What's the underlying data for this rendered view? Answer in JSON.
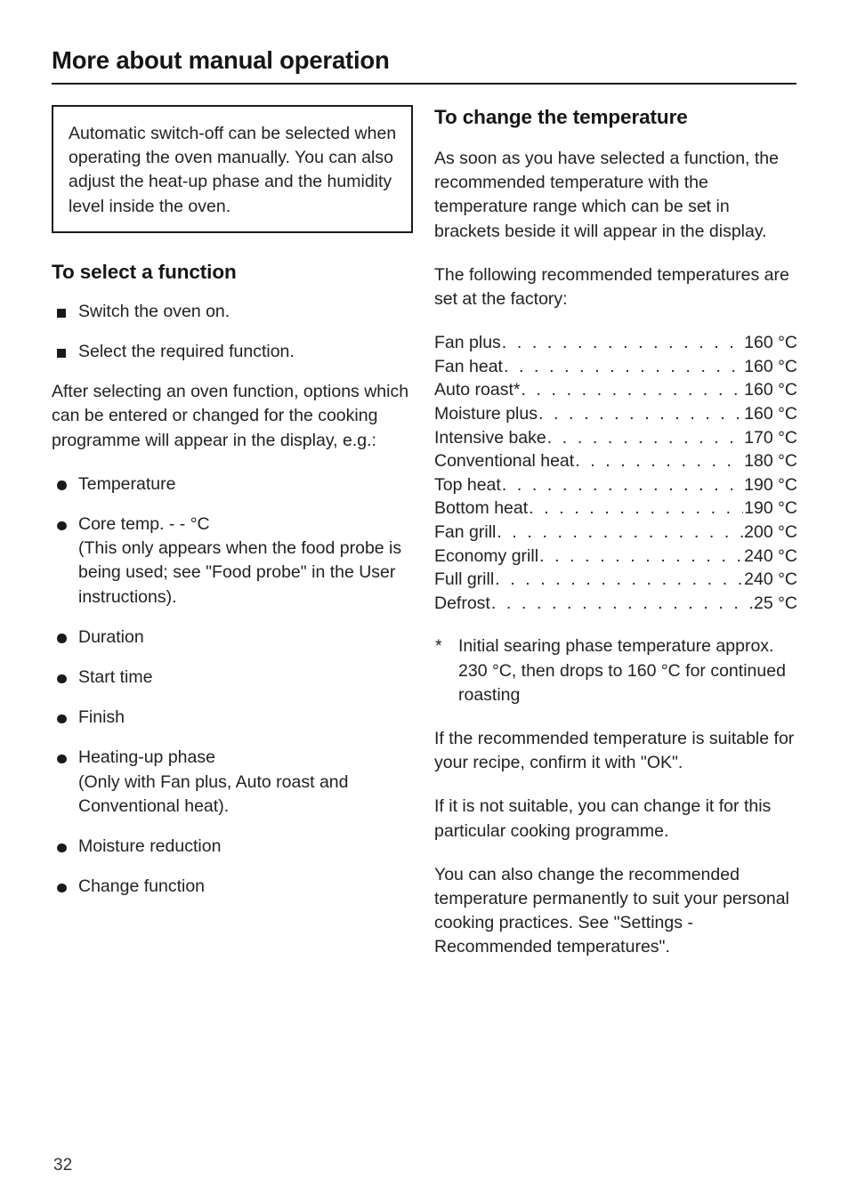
{
  "page": {
    "title": "More about manual operation",
    "number": "32"
  },
  "left_column": {
    "note_box": {
      "text": "Automatic switch-off can be selected when operating the oven manually. You can also adjust the heat-up phase and the humidity level inside the oven."
    },
    "section": {
      "heading": "To select a function",
      "steps": [
        "Switch the oven on.",
        "Select the required function."
      ],
      "paragraph": "After selecting an oven function, options which can be entered or changed for the cooking programme will appear in the display, e.g.:",
      "options": [
        {
          "label": "Temperature",
          "detail": ""
        },
        {
          "label": "Core temp. - - °C",
          "detail": "(This only appears when the food probe is being used; see \"Food probe\" in the User instructions)."
        },
        {
          "label": "Duration",
          "detail": ""
        },
        {
          "label": "Start time",
          "detail": ""
        },
        {
          "label": "Finish",
          "detail": ""
        },
        {
          "label": "Heating-up phase",
          "detail": "(Only with Fan plus, Auto roast and Conventional heat)."
        },
        {
          "label": "Moisture reduction",
          "detail": ""
        },
        {
          "label": "Change function",
          "detail": ""
        }
      ]
    }
  },
  "right_column": {
    "heading": "To change the temperature",
    "intro_paragraph": "As soon as you have selected a function, the recommended temperature with the temperature range which can be set in brackets beside it will appear in the display.",
    "factory_paragraph": "The following recommended temperatures are set at the factory:",
    "temperatures": [
      {
        "name": "Fan plus",
        "value": "160 °C"
      },
      {
        "name": "Fan heat",
        "value": "160 °C"
      },
      {
        "name": "Auto roast*",
        "value": "160 °C"
      },
      {
        "name": "Moisture plus",
        "value": "160 °C"
      },
      {
        "name": "Intensive bake",
        "value": "170 °C"
      },
      {
        "name": "Conventional heat",
        "value": "180 °C"
      },
      {
        "name": "Top heat",
        "value": "190 °C"
      },
      {
        "name": "Bottom heat",
        "value": "190 °C"
      },
      {
        "name": "Fan grill",
        "value": "200 °C"
      },
      {
        "name": "Economy grill",
        "value": "240 °C"
      },
      {
        "name": "Full grill",
        "value": "240 °C"
      },
      {
        "name": "Defrost",
        "value": "25 °C"
      }
    ],
    "footnote": {
      "marker": "*",
      "text": "Initial searing phase temperature approx. 230 °C, then drops to 160 °C for continued roasting"
    },
    "paragraphs": [
      "If the recommended temperature is suitable for your recipe, confirm it with \"OK\".",
      "If it is not suitable, you can change it for this particular cooking programme.",
      "You can also change the recommended temperature permanently to suit your personal cooking practices. See \"Settings - Recommended temperatures\"."
    ]
  }
}
